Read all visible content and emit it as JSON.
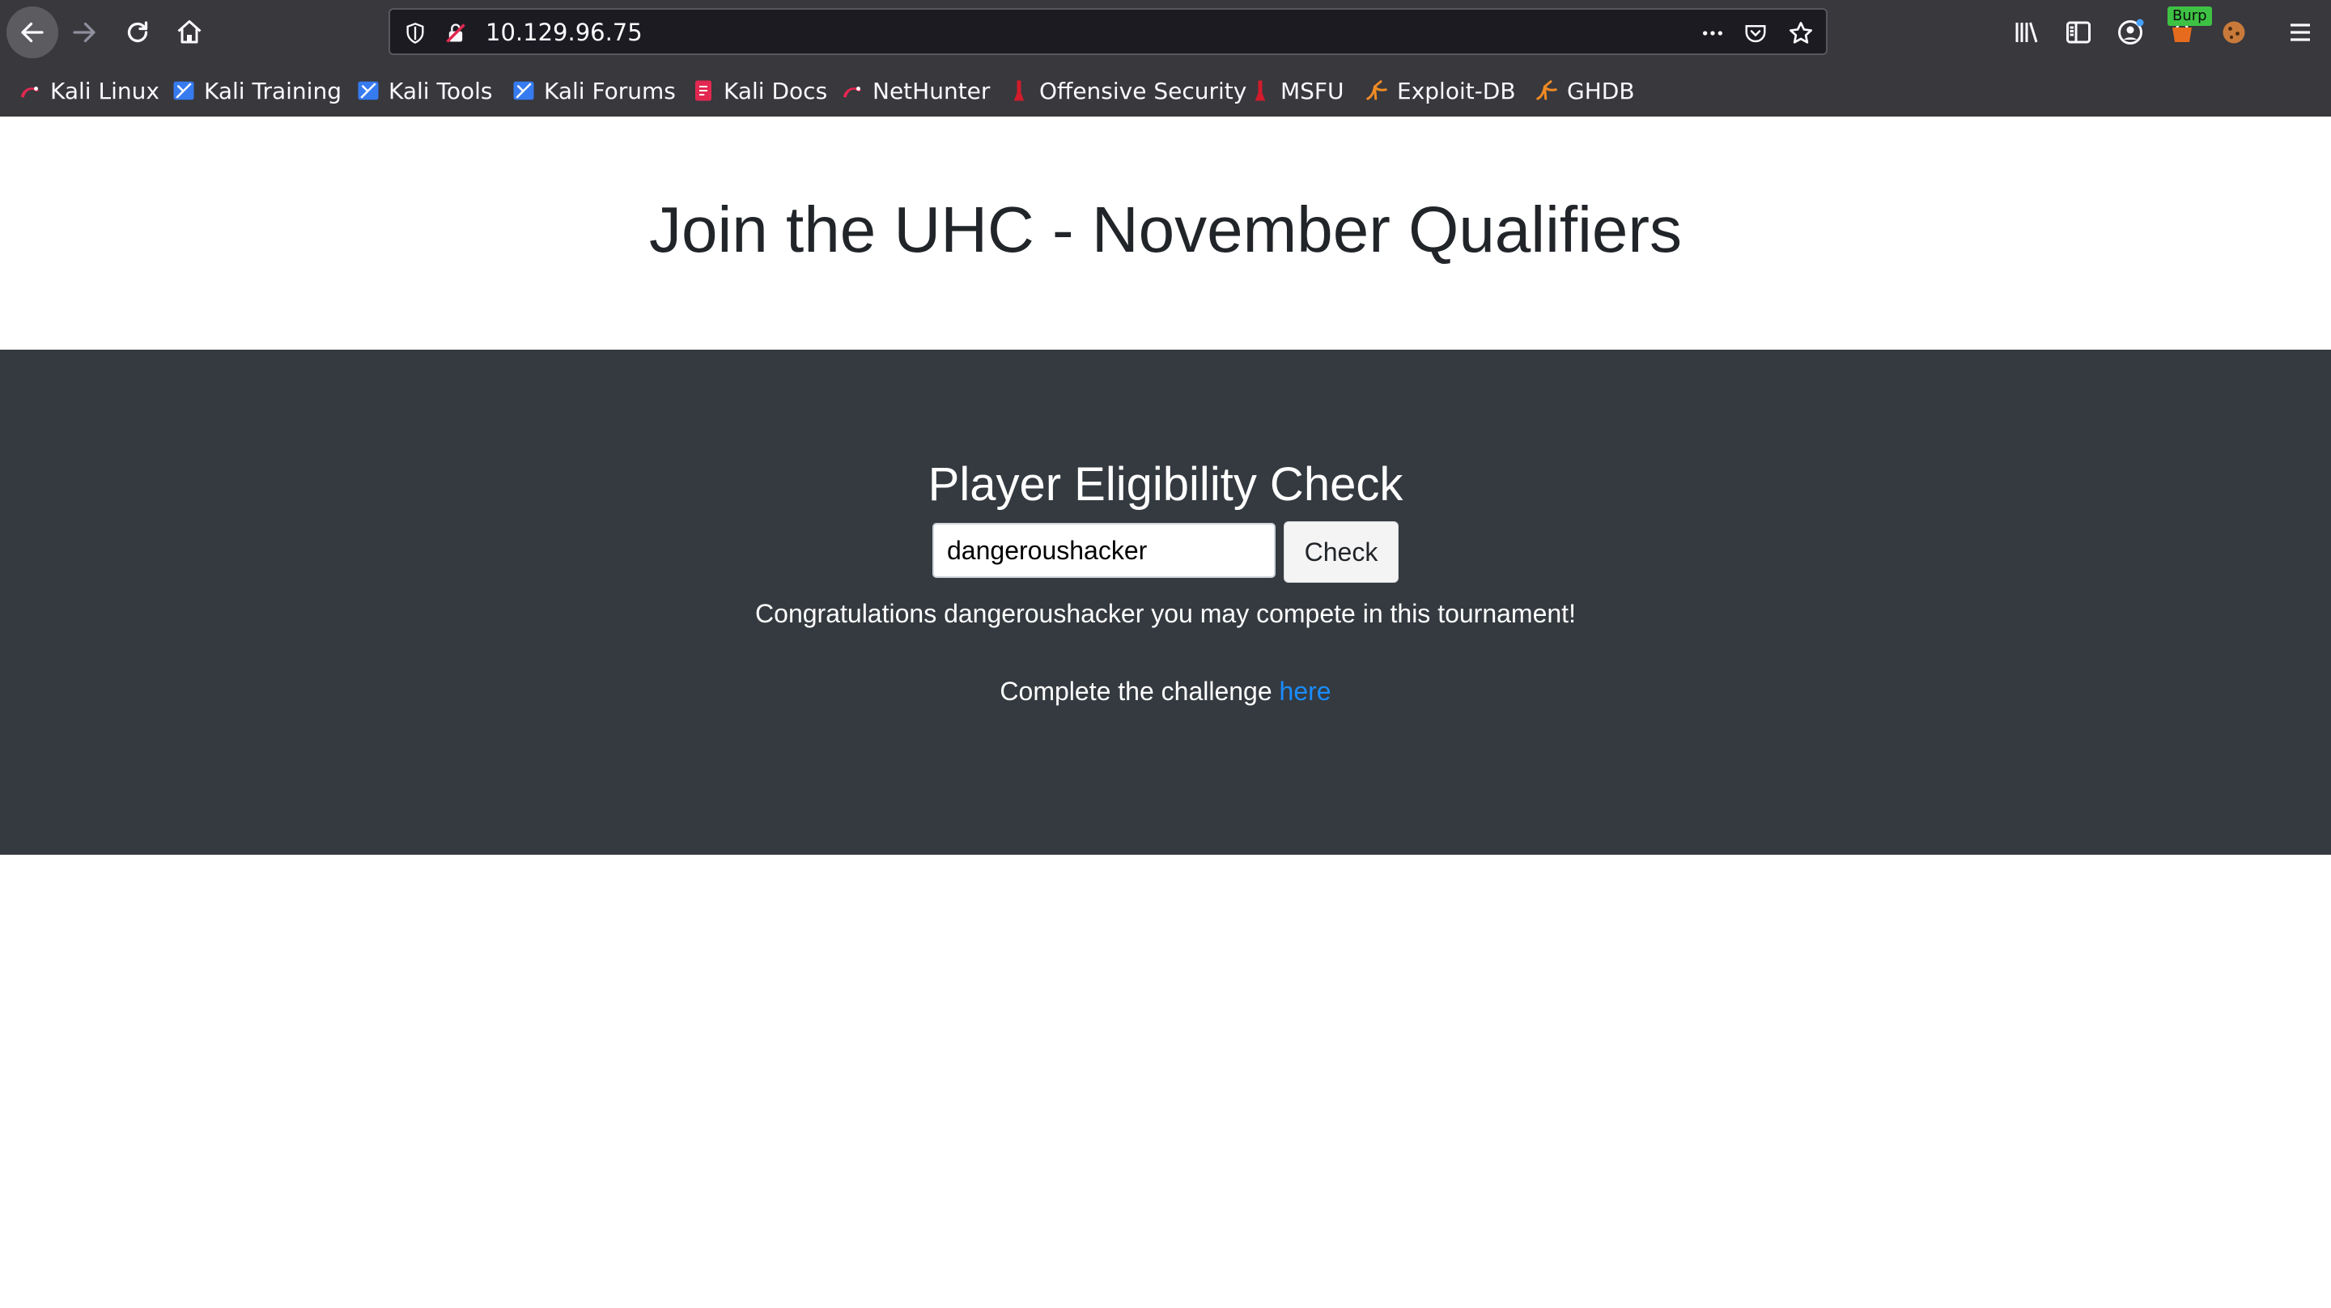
{
  "browser": {
    "url": "10.129.96.75",
    "burp_badge": "Burp",
    "bookmarks": [
      {
        "label": "Kali Linux",
        "icon": "kali-dragon-icon"
      },
      {
        "label": "Kali Training",
        "icon": "kali-training-icon"
      },
      {
        "label": "Kali Tools",
        "icon": "kali-tools-icon"
      },
      {
        "label": "Kali Forums",
        "icon": "kali-forums-icon"
      },
      {
        "label": "Kali Docs",
        "icon": "kali-docs-icon"
      },
      {
        "label": "NetHunter",
        "icon": "nethunter-icon"
      },
      {
        "label": "Offensive Security",
        "icon": "offsec-icon"
      },
      {
        "label": "MSFU",
        "icon": "msfu-icon"
      },
      {
        "label": "Exploit-DB",
        "icon": "exploit-db-icon"
      },
      {
        "label": "GHDB",
        "icon": "ghdb-icon"
      }
    ]
  },
  "page": {
    "title": "Join the UHC - November Qualifiers",
    "check": {
      "heading": "Player Eligibility Check",
      "input_value": "dangeroushacker",
      "button_label": "Check",
      "result": "Congratulations dangeroushacker you may compete in this tournament!",
      "challenge_prefix": "Complete the challenge",
      "challenge_link": "here"
    }
  },
  "colors": {
    "chrome": "#38383d",
    "url_field": "#1c1b22",
    "dark_section": "#343a40",
    "link": "#1a8cff",
    "burp_badge": "#3ec244"
  }
}
